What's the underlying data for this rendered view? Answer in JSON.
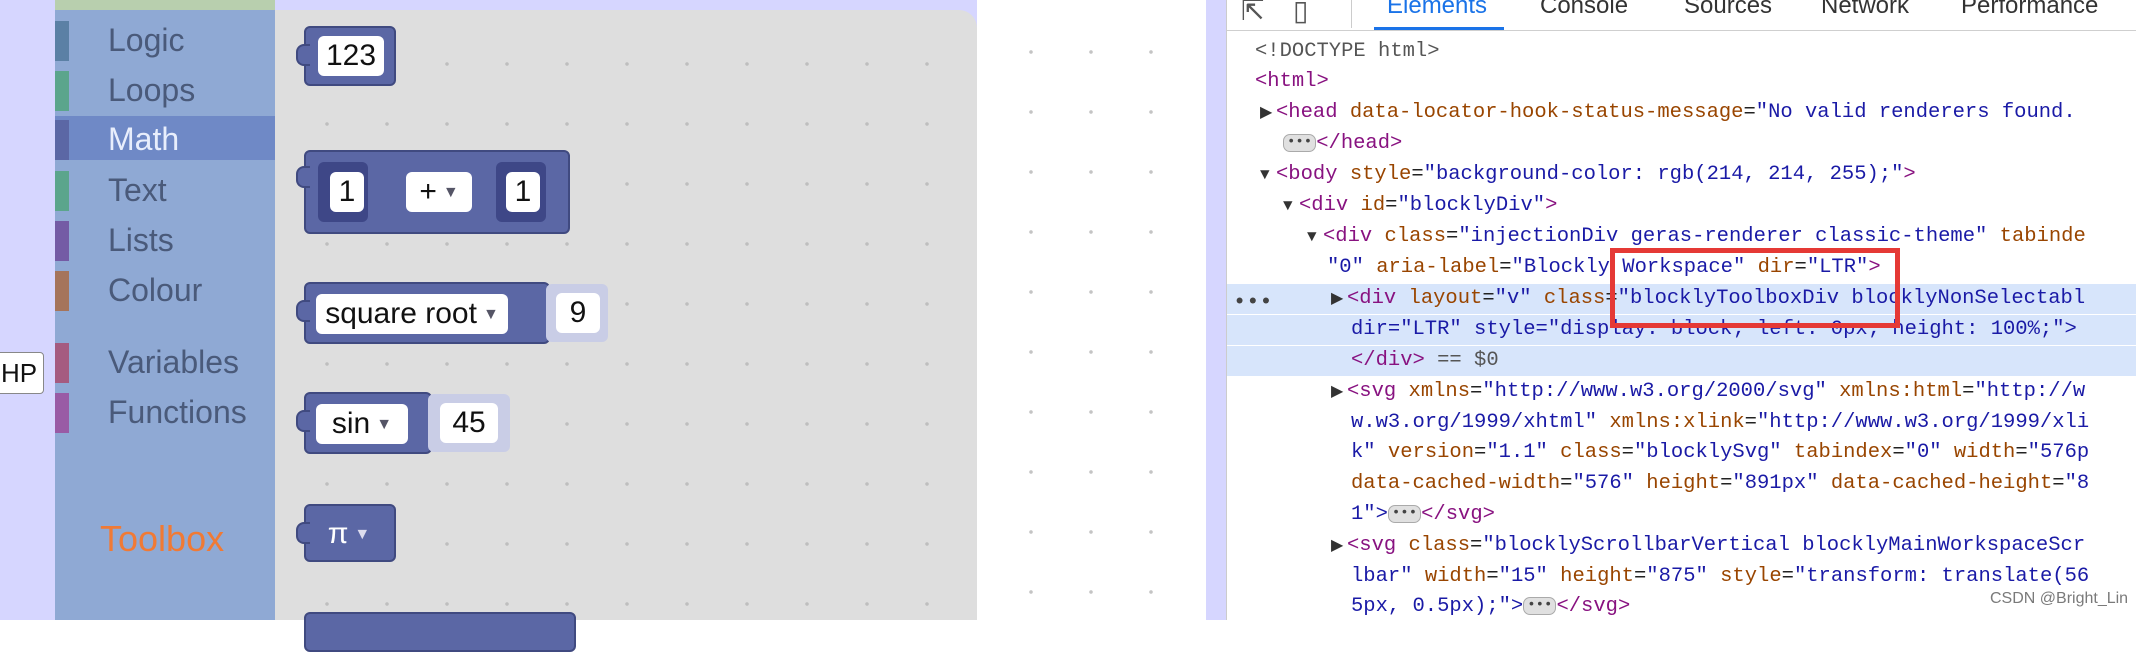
{
  "page": {
    "hp_button_label": "HP"
  },
  "toolbox": {
    "categories": [
      {
        "label": "Logic",
        "color": "#5b80a5"
      },
      {
        "label": "Loops",
        "color": "#5ba58c"
      },
      {
        "label": "Math",
        "color": "#5b67a5",
        "selected": true
      },
      {
        "label": "Text",
        "color": "#5ba58c"
      },
      {
        "label": "Lists",
        "color": "#745ba5"
      },
      {
        "label": "Colour",
        "color": "#a5745b"
      },
      {
        "label": "Variables",
        "color": "#a55b80"
      },
      {
        "label": "Functions",
        "color": "#995ba5"
      }
    ],
    "caption": "Toolbox"
  },
  "flyout": {
    "number_block": "123",
    "arithmetic": {
      "left": "1",
      "op": "+",
      "right": "1"
    },
    "single": {
      "op": "square root",
      "value": "9"
    },
    "trig": {
      "op": "sin",
      "value": "45"
    },
    "constant": {
      "value": "π"
    }
  },
  "devtools": {
    "tabs": [
      "Elements",
      "Console",
      "Sources",
      "Network",
      "Performance"
    ],
    "active_tab": "Elements",
    "lines": {
      "l0": "<!DOCTYPE html>",
      "l1": "<html>",
      "l2_tag": "<head ",
      "l2_attr": "data-locator-hook-status-message",
      "l2_val": "\"No valid renderers found.",
      "l3_tag": "</head>",
      "l4_tag": "<body ",
      "l4_attr": "style",
      "l4_val": "\"background-color: rgb(214, 214, 255);\"",
      "l5_tag": "<div ",
      "l5_attr": "id",
      "l5_val": "\"blocklyDiv\"",
      "l6_tag": "<div ",
      "l6_attr": "class",
      "l6_val": "\"injectionDiv geras-renderer classic-theme\"",
      "l6_attr2": " tabinde",
      "l7_val": "\"0\"",
      "l7_attr": " aria-label",
      "l7_val2": "\"Blockly Workspace\"",
      "l7_attr2": " dir",
      "l7_val3": "\"LTR\"",
      "l8_tag": "<div ",
      "l8_attr": "layout",
      "l8_val": "\"v\"",
      "l8_attr2": " class",
      "l8_val2": "\"blocklyToolboxDiv blocklyNonSelectabl",
      "l9_val": "dir=\"LTR\" style=\"display: block; left: 0px; height: 100%;\">",
      "l10_tag": "</div>",
      "l10_cm": " == $0",
      "l11_tag": "<svg ",
      "l11_attr": "xmlns",
      "l11_val": "\"http://www.w3.org/2000/svg\"",
      "l11_attr2": " xmlns:html",
      "l11_val2": "\"http://w",
      "l12_val": "w.w3.org/1999/xhtml\"",
      "l12_attr": " xmlns:xlink",
      "l12_val2": "\"http://www.w3.org/1999/xli",
      "l13_val": "k\"",
      "l13_attr": " version",
      "l13_val2": "\"1.1\"",
      "l13_attr2": " class",
      "l13_val3": "\"blocklySvg\"",
      "l13_attr3": " tabindex",
      "l13_val4": "\"0\"",
      "l13_attr4": " width",
      "l13_val5": "\"576p",
      "l14_attr": "data-cached-width",
      "l14_val": "\"576\"",
      "l14_attr2": " height",
      "l14_val2": "\"891px\"",
      "l14_attr3": " data-cached-height",
      "l14_val3": "\"8",
      "l15_val": "1\">",
      "l15_tag": "</svg>",
      "l16_tag": "<svg ",
      "l16_attr": "class",
      "l16_val": "\"blocklyScrollbarVertical blocklyMainWorkspaceScr",
      "l17_val": "lbar\"",
      "l17_attr": " width",
      "l17_val2": "\"15\"",
      "l17_attr2": " height",
      "l17_val3": "\"875\"",
      "l17_attr3": " style",
      "l17_val4": "\"transform: translate(56",
      "l18_val": "5px, 0.5px);\">",
      "l18_tag": "</svg>"
    },
    "dots_menu": "•••",
    "watermark": "CSDN @Bright_Lin"
  }
}
